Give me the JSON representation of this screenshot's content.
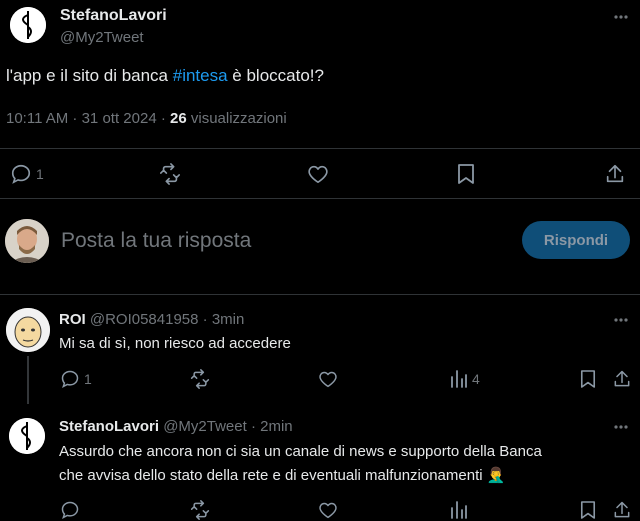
{
  "main_tweet": {
    "display_name": "StefanoLavori",
    "handle": "@My2Tweet",
    "text_before": "l'app e il sito di banca ",
    "hashtag": "#intesa",
    "text_after": " è bloccato!?",
    "time": "10:11 AM · 31 ott 2024 · ",
    "views_count": "26",
    "views_label": " visualizzazioni",
    "reply_count": "1"
  },
  "composer": {
    "placeholder": "Posta la tua risposta",
    "reply_button": "Rispondi"
  },
  "reply1": {
    "display_name": "ROI",
    "handle": "@ROI05841958",
    "time": " · 3min",
    "text": "Mi sa di sì, non riesco ad accedere",
    "reply_count": "1",
    "views_count": "4"
  },
  "reply2": {
    "display_name": "StefanoLavori",
    "handle": "@My2Tweet",
    "time": " · 2min",
    "text_line1": "Assurdo che ancora non ci sia un canale di news e supporto della Banca",
    "text_line2": "che avvisa dello stato della rete e di eventuali malfunzionamenti",
    "emoji": "🤦‍♂️"
  },
  "icons": {
    "more": "more-icon",
    "reply": "reply-icon",
    "retweet": "retweet-icon",
    "like": "like-icon",
    "views": "views-icon",
    "bookmark": "bookmark-icon",
    "share": "share-icon"
  },
  "colors": {
    "accent": "#1d9bf0",
    "reply_button_bg": "#0f4e78",
    "reply_button_text": "#8b98a5"
  }
}
